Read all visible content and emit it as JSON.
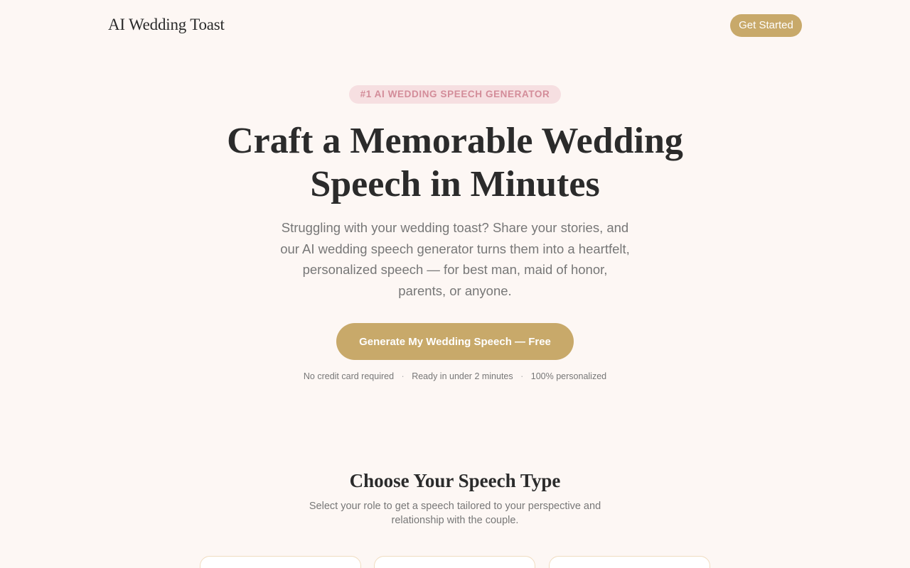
{
  "nav": {
    "brand": "AI Wedding Toast",
    "cta_label": "Get Started"
  },
  "hero": {
    "badge": "#1 AI WEDDING SPEECH GENERATOR",
    "title_line1": "Craft a Memorable Wedding",
    "title_line2": "Speech in Minutes",
    "subtitle_lines": [
      "Struggling with your wedding toast? Share your stories, and",
      "our AI wedding speech generator turns them into a heartfelt,",
      "personalized speech — for best man, maid of honor,",
      "parents, or anyone."
    ],
    "cta_label": "Generate My Wedding Speech — Free",
    "trust_items": [
      "No credit card required",
      "Ready in under 2 minutes",
      "100% personalized"
    ],
    "trust_separator": "·"
  },
  "speech_types": {
    "title": "Choose Your Speech Type",
    "subtitle_lines": [
      "Select your role to get a speech tailored to your perspective and",
      "relationship with the couple."
    ]
  },
  "colors": {
    "background": "#fdf7f4",
    "accent_gold": "#c8a96a",
    "badge_bg": "#f6dfe1",
    "badge_text": "#d38c99",
    "muted_text": "#777777",
    "heading_text": "#2b2b2b"
  }
}
